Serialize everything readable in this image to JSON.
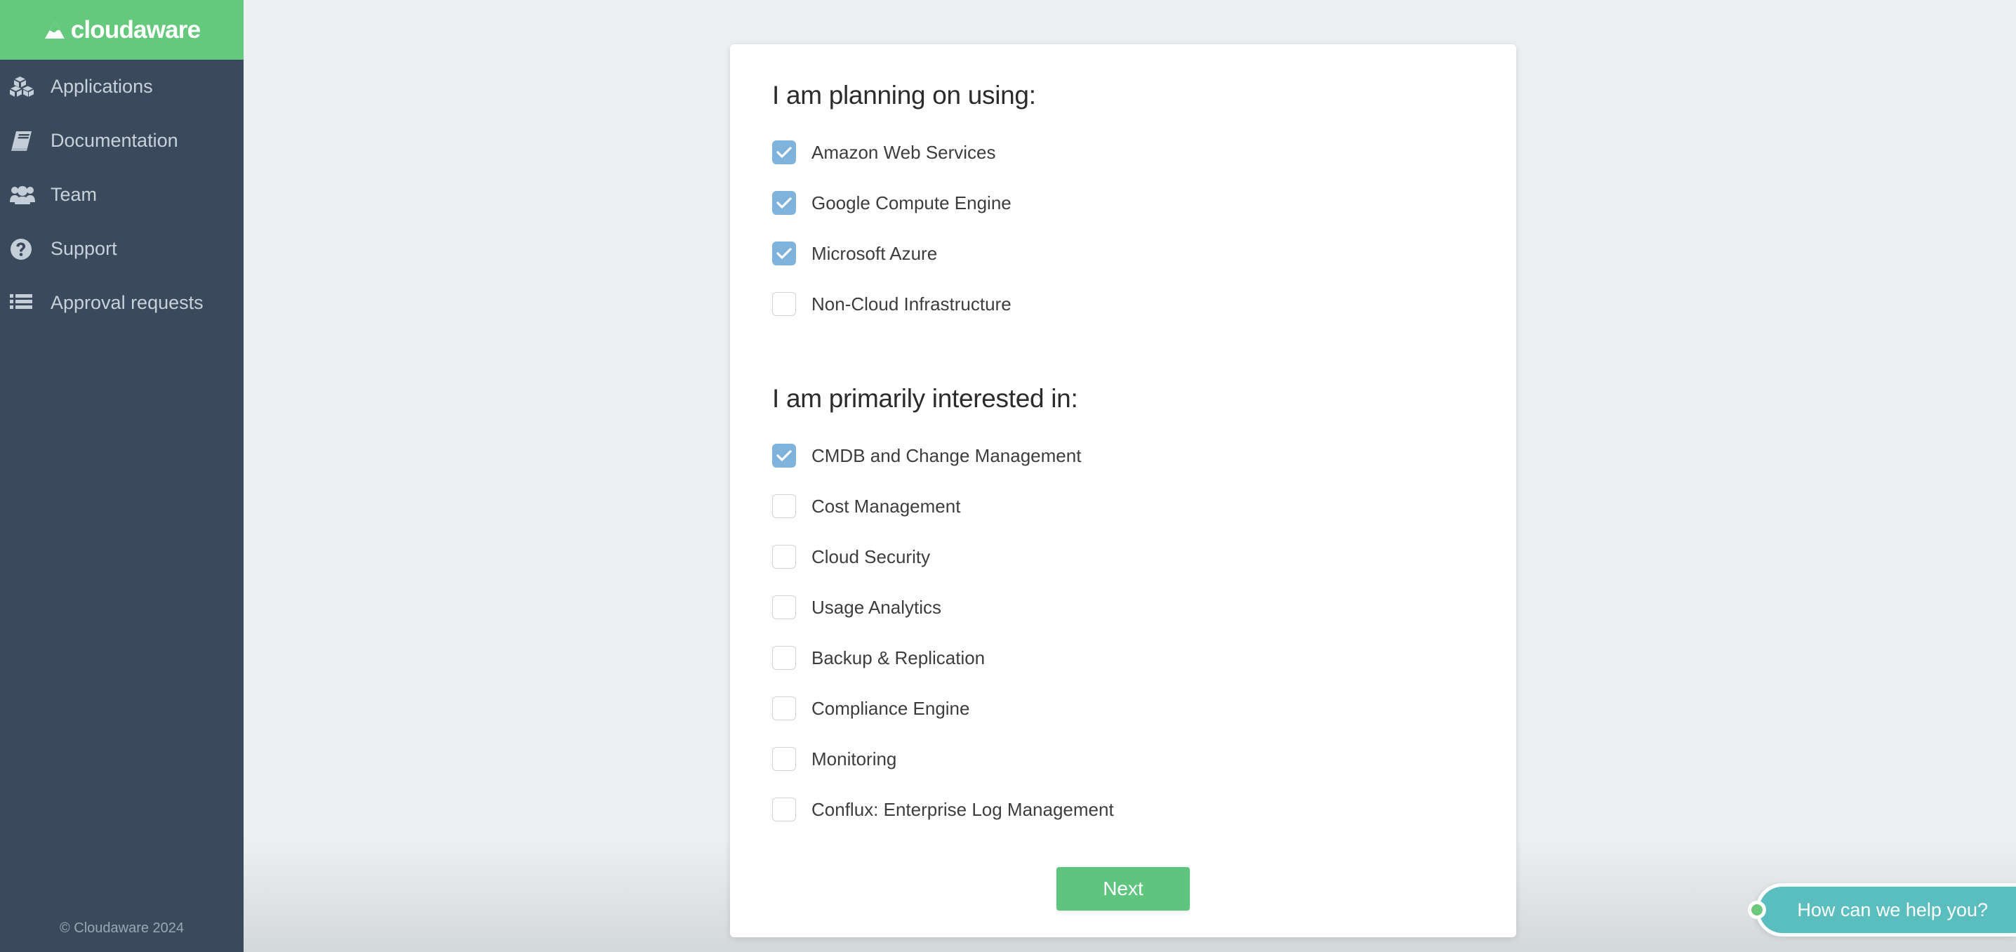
{
  "sidebar": {
    "logo": {
      "text": "cloudaware",
      "icon": "cloudaware-logo-icon"
    },
    "items": [
      {
        "label": "Applications",
        "icon": "boxes-icon"
      },
      {
        "label": "Documentation",
        "icon": "book-icon"
      },
      {
        "label": "Team",
        "icon": "users-icon"
      },
      {
        "label": "Support",
        "icon": "question-circle-icon"
      },
      {
        "label": "Approval requests",
        "icon": "list-icon"
      }
    ],
    "footer": "© Cloudaware 2024"
  },
  "card": {
    "section_one": {
      "title": "I am planning on using:",
      "options": [
        {
          "label": "Amazon Web Services",
          "checked": true
        },
        {
          "label": "Google Compute Engine",
          "checked": true
        },
        {
          "label": "Microsoft Azure",
          "checked": true
        },
        {
          "label": "Non-Cloud Infrastructure",
          "checked": false
        }
      ]
    },
    "section_two": {
      "title": "I am primarily interested in:",
      "options": [
        {
          "label": "CMDB and Change Management",
          "checked": true
        },
        {
          "label": "Cost Management",
          "checked": false
        },
        {
          "label": "Cloud Security",
          "checked": false
        },
        {
          "label": "Usage Analytics",
          "checked": false
        },
        {
          "label": "Backup & Replication",
          "checked": false
        },
        {
          "label": "Compliance Engine",
          "checked": false
        },
        {
          "label": "Monitoring",
          "checked": false
        },
        {
          "label": "Conflux: Enterprise Log Management",
          "checked": false
        }
      ]
    },
    "next_label": "Next"
  },
  "chat": {
    "text": "How can we help you?",
    "status_icon": "online-status-dot"
  },
  "colors": {
    "brand_green": "#64c97c",
    "sidebar_dark": "#3a4a5c",
    "checkbox_blue": "#7fb3dc",
    "button_green": "#5fc47e",
    "chat_teal": "#5bbebe",
    "page_bg": "#edf0f1"
  }
}
